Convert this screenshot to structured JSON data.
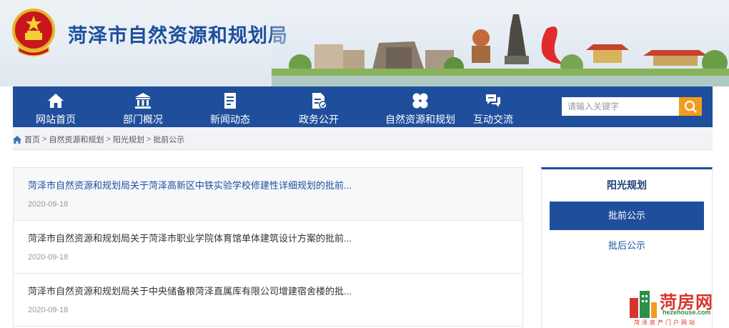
{
  "header": {
    "site_title": "菏泽市自然资源和规划局"
  },
  "nav": {
    "items": [
      {
        "label": "网站首页",
        "icon": "home-icon"
      },
      {
        "label": "部门概况",
        "icon": "institution-icon"
      },
      {
        "label": "新闻动态",
        "icon": "document-icon"
      },
      {
        "label": "政务公开",
        "icon": "file-edit-icon"
      },
      {
        "label": "自然资源和规划",
        "icon": "clover-icon"
      },
      {
        "label": "互动交流",
        "icon": "chat-icon"
      }
    ],
    "search_placeholder": "请输入关键字"
  },
  "breadcrumb": {
    "items": [
      "首页",
      "自然资源和规划",
      "阳光规划",
      "批前公示"
    ],
    "separator": ">"
  },
  "articles": [
    {
      "title": "菏泽市自然资源和规划局关于菏泽高新区中铁实验学校修建性详细规划的批前...",
      "date": "2020-09-18",
      "active": true
    },
    {
      "title": "菏泽市自然资源和规划局关于菏泽市职业学院体育馆单体建筑设计方案的批前...",
      "date": "2020-09-18",
      "active": false
    },
    {
      "title": "菏泽市自然资源和规划局关于中央储备粮菏泽直属库有限公司增建宿舍楼的批...",
      "date": "2020-09-18",
      "active": false
    }
  ],
  "sidebar": {
    "title": "阳光规划",
    "links": [
      {
        "label": "批前公示",
        "selected": true
      },
      {
        "label": "批后公示",
        "selected": false
      }
    ]
  },
  "watermark": {
    "name": "菏房网",
    "url": "hezehouse.com",
    "slogan": "菏泽房产门户网站"
  },
  "colors": {
    "primary": "#1f4f9c",
    "search_button": "#f29c1f",
    "watermark_red": "#d9342b"
  }
}
